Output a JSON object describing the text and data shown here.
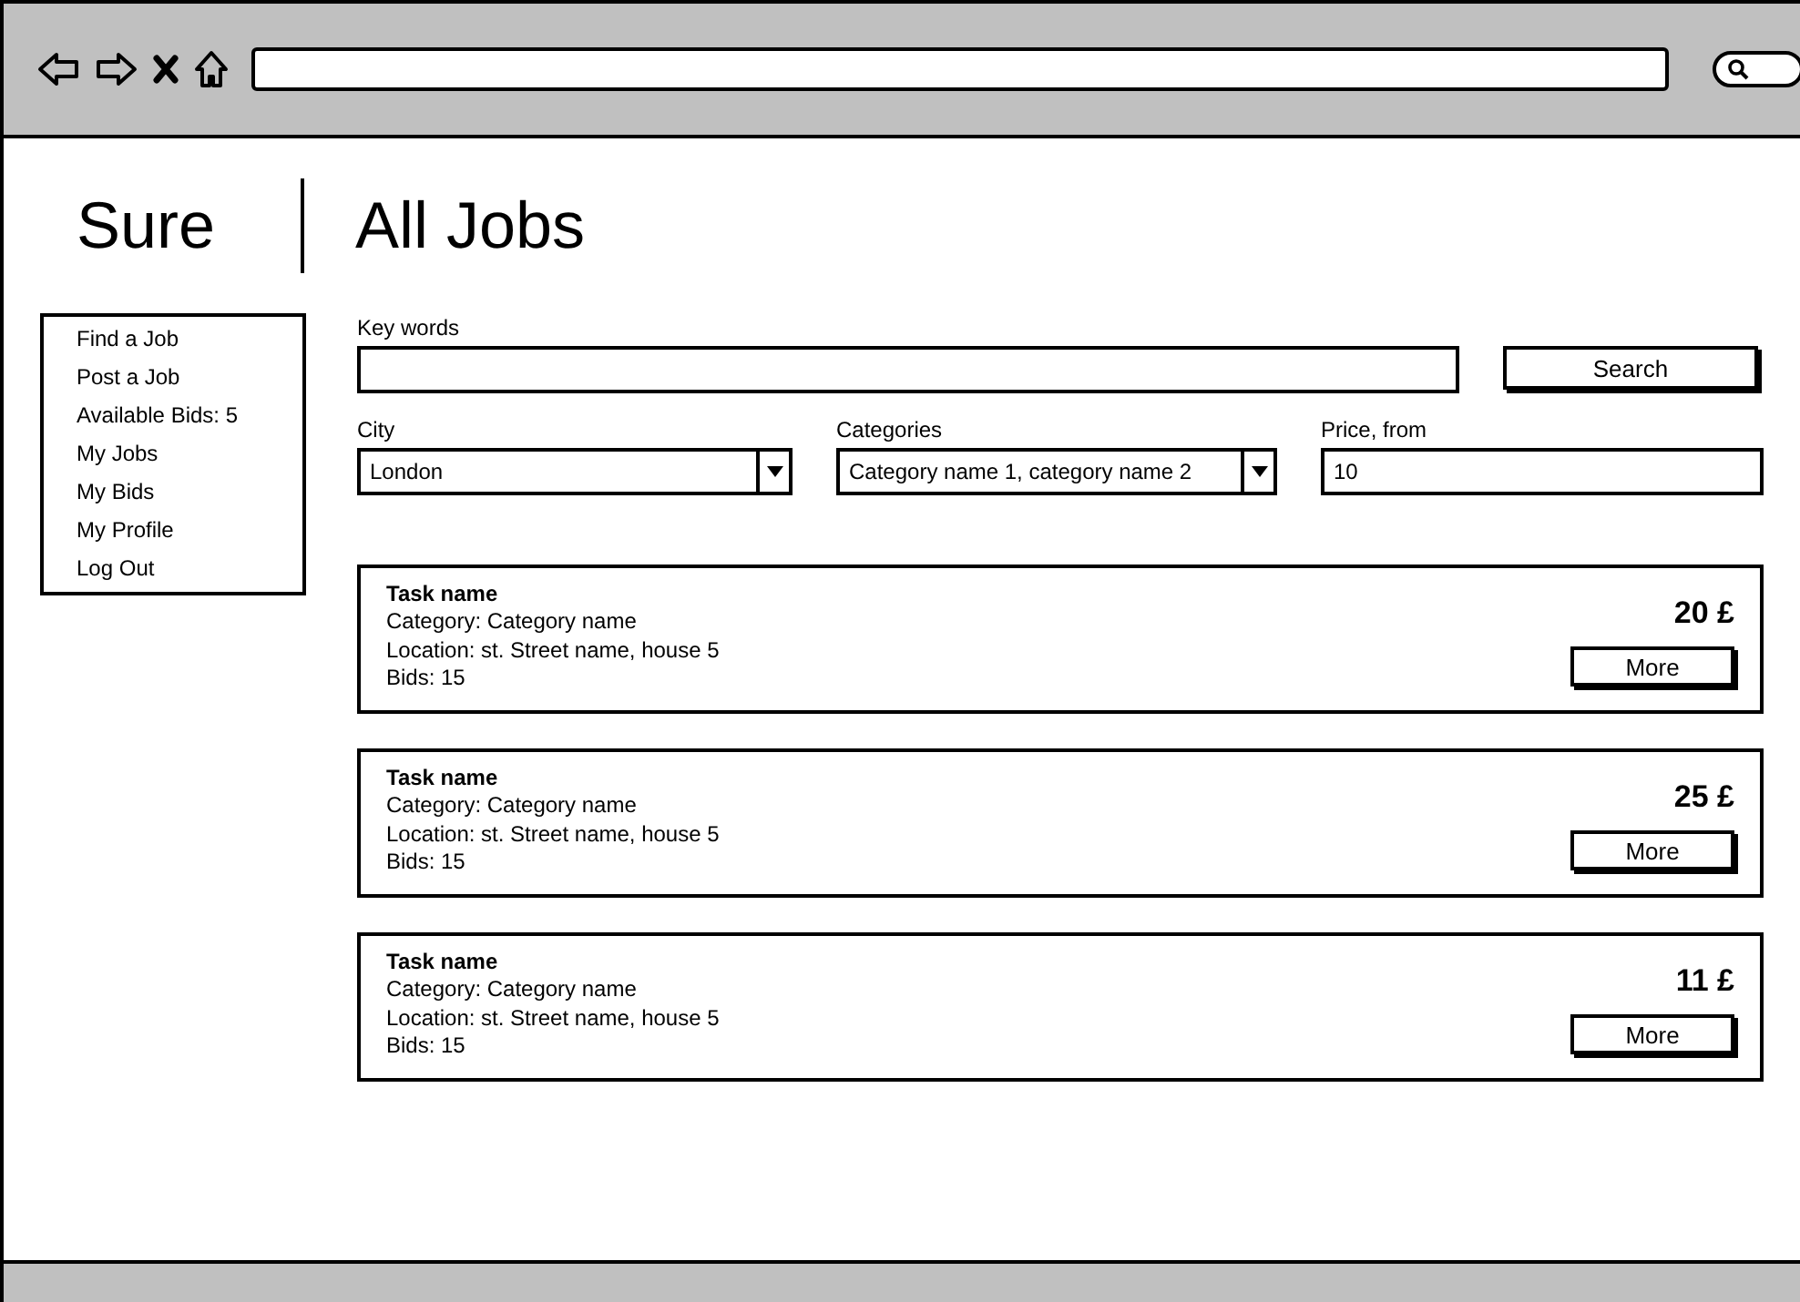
{
  "logo": "Sure",
  "title": "All Jobs",
  "sidebar": {
    "items": [
      "Find a Job",
      "Post a Job",
      "Available Bids: 5",
      "My Jobs",
      "My Bids",
      "My Profile",
      "Log Out"
    ]
  },
  "filters": {
    "keywords": {
      "label": "Key words"
    },
    "search_button": "Search",
    "city": {
      "label": "City",
      "value": "London"
    },
    "categories": {
      "label": "Categories",
      "value": "Category name 1, category name 2"
    },
    "price": {
      "label": "Price, from",
      "value": "10"
    }
  },
  "jobs": [
    {
      "name": "Task name",
      "category": "Category: Category name",
      "location": "Location: st. Street name, house 5",
      "bids": "Bids: 15",
      "price": "20 £",
      "button": "More"
    },
    {
      "name": "Task name",
      "category": "Category: Category name",
      "location": "Location: st. Street name, house 5",
      "bids": "Bids: 15",
      "price": "25 £",
      "button": "More"
    },
    {
      "name": "Task name",
      "category": "Category: Category name",
      "location": "Location: st. Street name, house 5",
      "bids": "Bids: 15",
      "price": "11 £",
      "button": "More"
    }
  ]
}
